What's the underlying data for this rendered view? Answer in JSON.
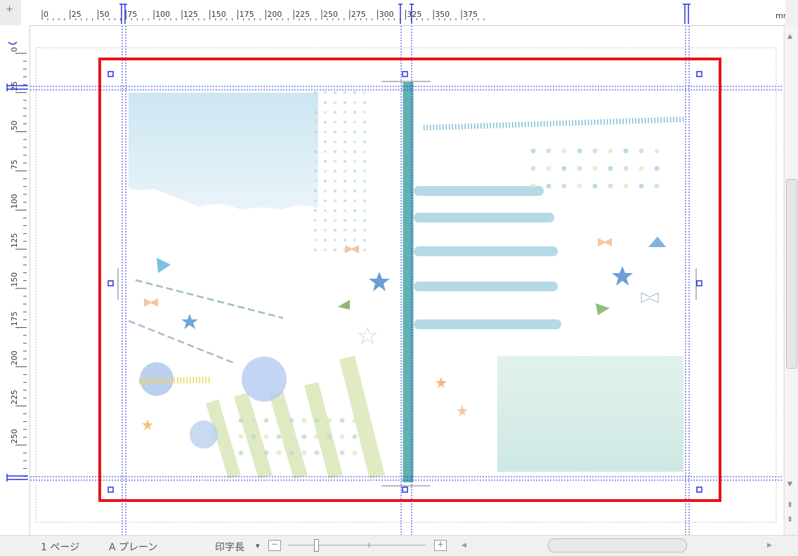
{
  "ruler": {
    "corner_glyph": "+",
    "unit": "mm",
    "h_ticks": [
      "0",
      "25",
      "50",
      "75",
      "100",
      "125",
      "150",
      "175",
      "200",
      "225",
      "250",
      "275",
      "300",
      "325",
      "350",
      "375"
    ],
    "v_ticks": [
      "0",
      "25",
      "50",
      "75",
      "100",
      "125",
      "150",
      "175",
      "200",
      "225",
      "250"
    ]
  },
  "status": {
    "page_label": "1 ページ",
    "plane_label": "A プレーン",
    "print_length_label": "印字長",
    "dropdown_glyph": "▾",
    "zoom_out_glyph": "－",
    "zoom_in_glyph": "＋"
  },
  "scroll": {
    "up_glyph": "▲",
    "down_glyph": "▼",
    "page_up_glyph": "⇞",
    "page_down_glyph": "⇟",
    "left_glyph": "◀",
    "right_glyph": "▶"
  },
  "colors": {
    "selection": "#e8141a",
    "guide": "#2233dd",
    "spine": "#4faaaa"
  }
}
